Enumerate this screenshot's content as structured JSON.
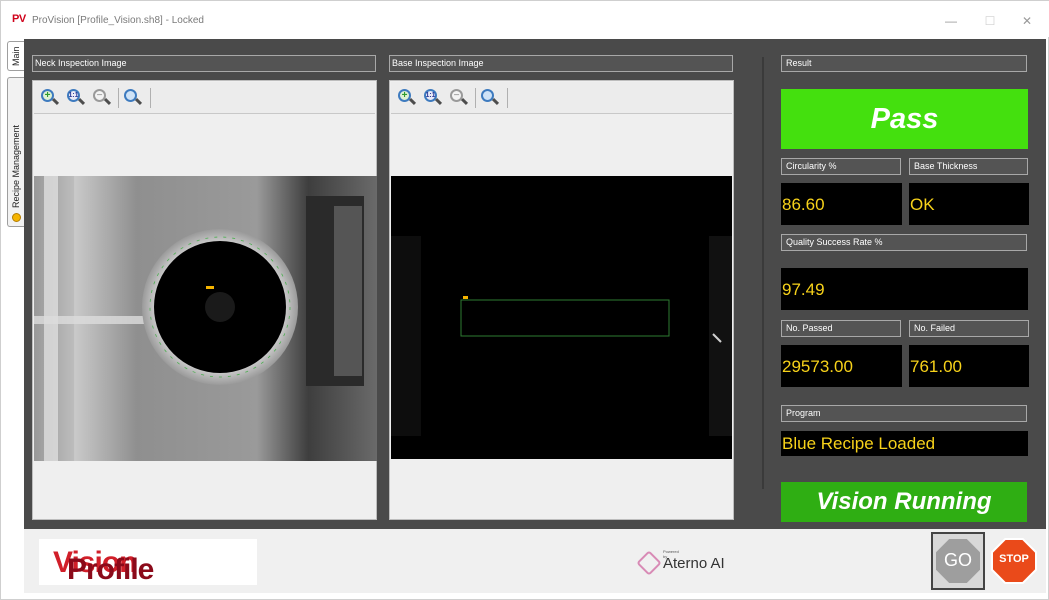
{
  "window": {
    "app_logo": "PV",
    "title": "ProVision [Profile_Vision.sh8] - Locked",
    "minimize_glyph": "—",
    "maximize_glyph": "☐",
    "close_glyph": "✕"
  },
  "side_tabs": {
    "main": "Main",
    "recipe": "Recipe Management"
  },
  "neck_panel": {
    "label": "Neck Inspection Image"
  },
  "base_panel": {
    "label": "Base Inspection Image"
  },
  "toolbar_icons": [
    "zoom-in-icon",
    "zoom-fit-icon",
    "zoom-out-icon",
    "zoom-reset-icon"
  ],
  "result": {
    "label": "Result",
    "status": "Pass",
    "status_color": "#44e00e",
    "circularity_label": "Circularity %",
    "circularity_value": "86.60",
    "base_thickness_label": "Base Thickness",
    "base_thickness_value": "OK",
    "quality_label": "Quality Success Rate %",
    "quality_value": "97.49",
    "passed_label": "No. Passed",
    "passed_value": "29573.00",
    "failed_label": "No. Failed",
    "failed_value": "761.00",
    "program_label": "Program",
    "program_value": "Blue Recipe Loaded",
    "running_text": "Vision Running",
    "running_color": "#2fae13",
    "value_color": "#f7d21a"
  },
  "footer": {
    "brand_part1": "Profile",
    "brand_part2": "Vision",
    "powered_by": "Powered by",
    "partner": "Aterno AI",
    "go_label": "GO",
    "stop_label": "STOP"
  }
}
